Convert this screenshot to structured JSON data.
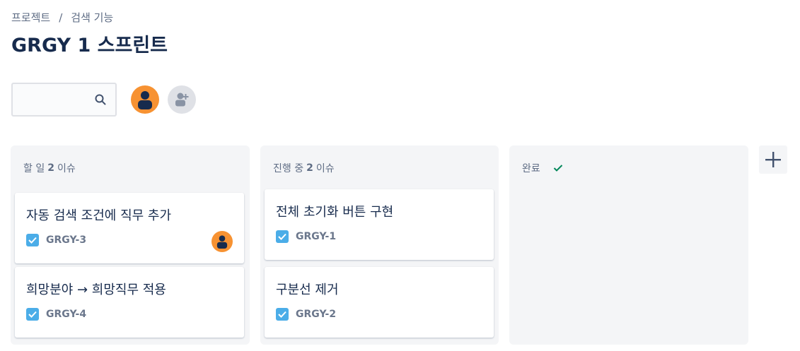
{
  "breadcrumb": {
    "items": [
      "프로젝트",
      "검색 기능"
    ],
    "separator": "/"
  },
  "page_title": "GRGY 1 스프린트",
  "toolbar": {
    "search_value": "",
    "search_placeholder": "",
    "search_icon": "search-icon",
    "user_avatar_icon": "user-avatar-icon",
    "add_people_icon": "add-people-icon"
  },
  "columns": [
    {
      "name": "할 일",
      "count": "2",
      "suffix": "이슈",
      "cards": [
        {
          "title": "자동 검색 조건에 직무 추가",
          "key": "GRGY-3",
          "assignee": true
        },
        {
          "title": "희망분야 → 희망직무 적용",
          "key": "GRGY-4",
          "assignee": false
        }
      ]
    },
    {
      "name": "진행 중",
      "count": "2",
      "suffix": "이슈",
      "cards": [
        {
          "title": "전체 초기화 버튼 구현",
          "key": "GRGY-1",
          "assignee": false
        },
        {
          "title": "구분선 제거",
          "key": "GRGY-2",
          "assignee": false
        }
      ]
    },
    {
      "name": "완료",
      "done_icon": "checkmark-icon",
      "cards": []
    }
  ],
  "add_column_icon": "plus-icon",
  "colors": {
    "accent_orange": "#f79232",
    "task_blue": "#4bade8",
    "done_green": "#00875a",
    "column_bg": "#f4f5f7"
  }
}
